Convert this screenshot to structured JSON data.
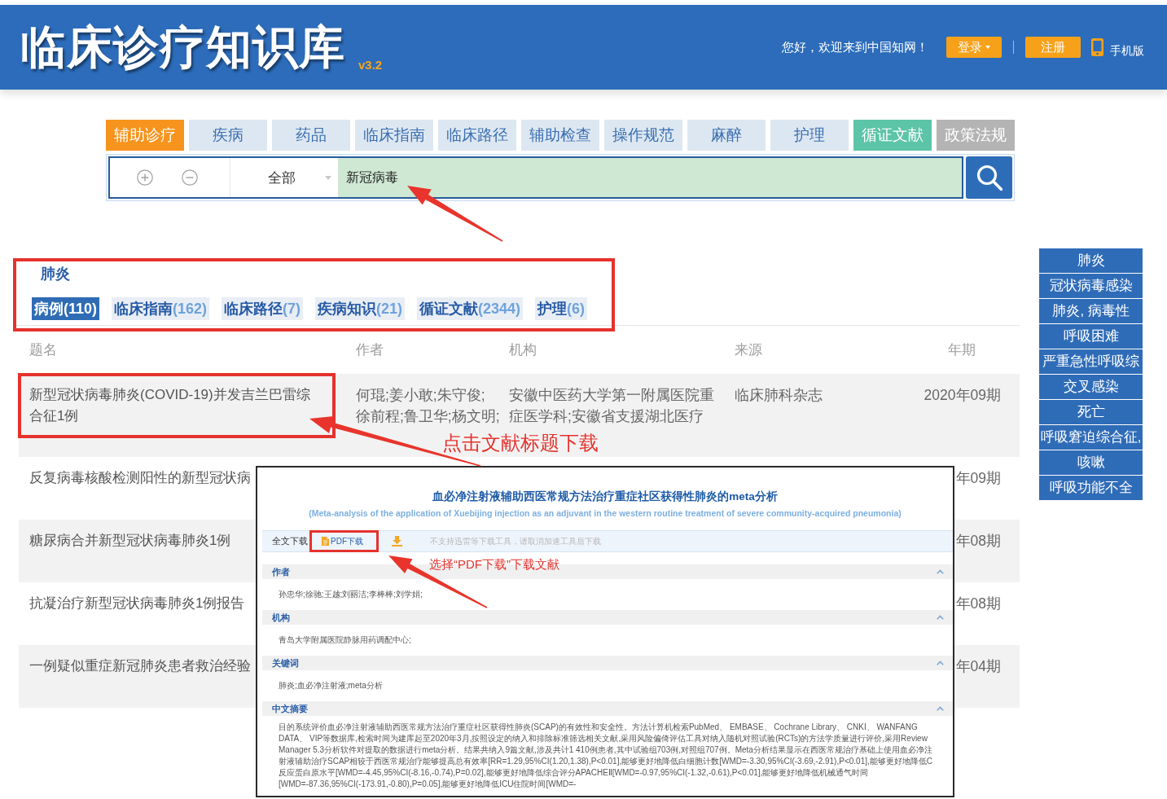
{
  "header": {
    "title": "临床诊疗知识库",
    "version": "v3.2",
    "greeting": "您好，欢迎来到中国知网！",
    "login": "登录",
    "register": "注册",
    "mobile": "手机版"
  },
  "nav_tabs": [
    {
      "label": "辅助诊疗",
      "selected": true
    },
    {
      "label": "疾病",
      "selected": false
    },
    {
      "label": "药品",
      "selected": false
    },
    {
      "label": "临床指南",
      "selected": false
    },
    {
      "label": "临床路径",
      "selected": false
    },
    {
      "label": "辅助检查",
      "selected": false
    },
    {
      "label": "操作规范",
      "selected": false
    },
    {
      "label": "麻醉",
      "selected": false
    },
    {
      "label": "护理",
      "selected": false
    },
    {
      "label": "循证文献",
      "selected": false,
      "color": "#5cc4a7"
    },
    {
      "label": "政策法规",
      "selected": false,
      "color": "#b4b4b4"
    }
  ],
  "search": {
    "scope": "全部",
    "value": "新冠病毒"
  },
  "categories": {
    "heading": "肺炎",
    "highlighted": true,
    "tabs": [
      {
        "label": "病例",
        "count": "(110)",
        "selected": true
      },
      {
        "label": "临床指南",
        "count": "(162)",
        "selected": false
      },
      {
        "label": "临床路径",
        "count": "(7)",
        "selected": false
      },
      {
        "label": "疾病知识",
        "count": "(21)",
        "selected": false
      },
      {
        "label": "循证文献",
        "count": "(2344)",
        "selected": false
      },
      {
        "label": "护理",
        "count": "(6)",
        "selected": false
      }
    ]
  },
  "table": {
    "columns": [
      "题名",
      "作者",
      "机构",
      "来源",
      "年期"
    ],
    "rows": [
      {
        "title": "新型冠状病毒肺炎(COVID-19)并发吉兰巴雷综合征1例",
        "authors": "何琨;姜小敢;朱守俊;徐前程;鲁卫华;杨文明;",
        "organization": "安徽中医药大学第一附属医院重症医学科;安徽省支援湖北医疗",
        "source": "临床肺科杂志",
        "issue": "2020年09期",
        "highlighted": true,
        "callout": "点击文献标题下载"
      },
      {
        "title": "反复病毒核酸检测阳性的新型冠状病",
        "issue": "年09期",
        "highlighted": false
      },
      {
        "title": "糖尿病合并新型冠状病毒肺炎1例",
        "issue": "年08期",
        "highlighted": false
      },
      {
        "title": "抗凝治疗新型冠状病毒肺炎1例报告",
        "issue": "年08期",
        "highlighted": false
      },
      {
        "title": "一例疑似重症新冠肺炎患者救治经验",
        "issue": "年04期",
        "highlighted": false
      }
    ]
  },
  "keywords": [
    "肺炎",
    "冠状病毒感染",
    "肺炎, 病毒性",
    "呼吸困难",
    "严重急性呼吸综",
    "交叉感染",
    "死亡",
    "呼吸窘迫综合征,",
    "咳嗽",
    "呼吸功能不全"
  ],
  "article_popup": {
    "title": "血必净注射液辅助西医常规方法治疗重症社区获得性肺炎的meta分析",
    "subtitle": "(Meta-analysis of the application of Xuebijing injection as an adjuvant in the western routine treatment of severe community-acquired pneumonia)",
    "download": {
      "label": "全文下载",
      "pdf": "PDF下载",
      "highlighted": true,
      "note": "不支持迅雷等下载工具，请取消加速工具后下载",
      "callout": "选择“PDF下载”下载文献"
    },
    "sections": [
      {
        "heading": "作者",
        "expanded": true,
        "text": "孙忠华;徐驰;王越;刘丽洁;李棒棒;刘学娟;"
      },
      {
        "heading": "机构",
        "expanded": true,
        "text": "青岛大学附属医院静脉用药调配中心;"
      },
      {
        "heading": "关键词",
        "expanded": true,
        "text": "肺炎;血必净注射液;meta分析"
      },
      {
        "heading": "中文摘要",
        "expanded": true,
        "text": "目的系统评价血必净注射液辅助西医常规方法治疗重症社区获得性肺炎(SCAP)的有效性和安全性。方法计算机检索PubMed、 EMBASE、 Cochrane Library、 CNKI、 WANFANG DATA、 VIP等数据库,检索时间为建库起至2020年3月,按照设定的纳入和排除标准筛选相关文献,采用风险偏倚评估工具对纳入随机对照试验(RCTs)的方法学质量进行评价,采用Review Manager 5.3分析软件对提取的数据进行meta分析。结果共纳入9篇文献,涉及共计1 410例患者,其中试验组703例,对照组707例。Meta分析结果显示在西医常规治疗基础上使用血必净注射液辅助治疗SCAP相较于西医常规治疗能够提高总有效率[RR=1.29,95%CI(1.20,1.38),P<0.01],能够更好地降低白细胞计数[WMD=-3.30,95%CI(-3.69,-2.91),P<0.01],能够更好地降低C反应蛋白原水平[WMD=-4.45,95%CI(-8.16,-0.74),P=0.02],能够更好地降低综合评分APACHEⅡ[WMD=-0.97,95%CI(-1.32,-0.61),P<0.01],能够更好地降低机械通气时间[WMD=-87.36,95%CI(-173.91,-0.80),P=0.05],能够更好地降低ICU住院时间[WMD=-"
      }
    ]
  }
}
